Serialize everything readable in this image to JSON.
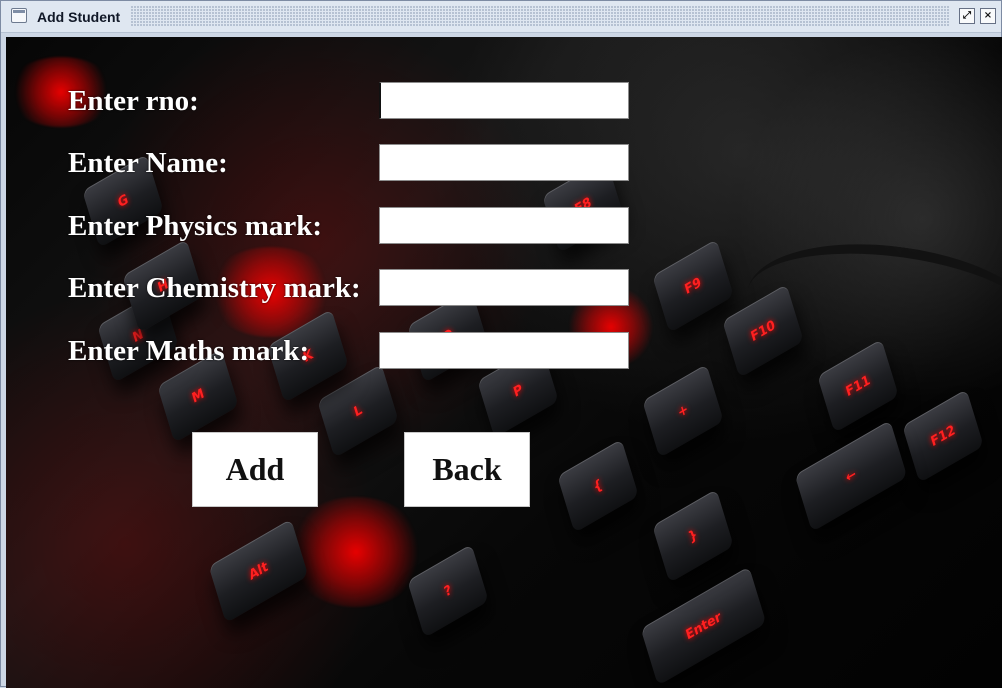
{
  "window": {
    "title": "Add Student",
    "controls": {
      "restore_maximize": "⤢",
      "close": "×"
    }
  },
  "form": {
    "fields": [
      {
        "label": "Enter rno:",
        "value": "",
        "placeholder": ""
      },
      {
        "label": "Enter Name:",
        "value": "",
        "placeholder": ""
      },
      {
        "label": "Enter Physics mark:",
        "value": "",
        "placeholder": ""
      },
      {
        "label": "Enter Chemistry mark:",
        "value": "",
        "placeholder": ""
      },
      {
        "label": "Enter Maths mark:",
        "value": "",
        "placeholder": ""
      }
    ],
    "buttons": {
      "add": "Add",
      "back": "Back"
    }
  },
  "background": {
    "keyboard_keys": [
      "F9",
      "F10",
      "F11",
      "F12",
      "+",
      "←",
      "L",
      "P",
      "O",
      "K",
      "M",
      "N",
      "H",
      "G",
      "F8",
      "Alt",
      "Enter",
      "?",
      "}",
      "{"
    ],
    "accent_red": "#ff2020",
    "dark_background": "#080808"
  }
}
